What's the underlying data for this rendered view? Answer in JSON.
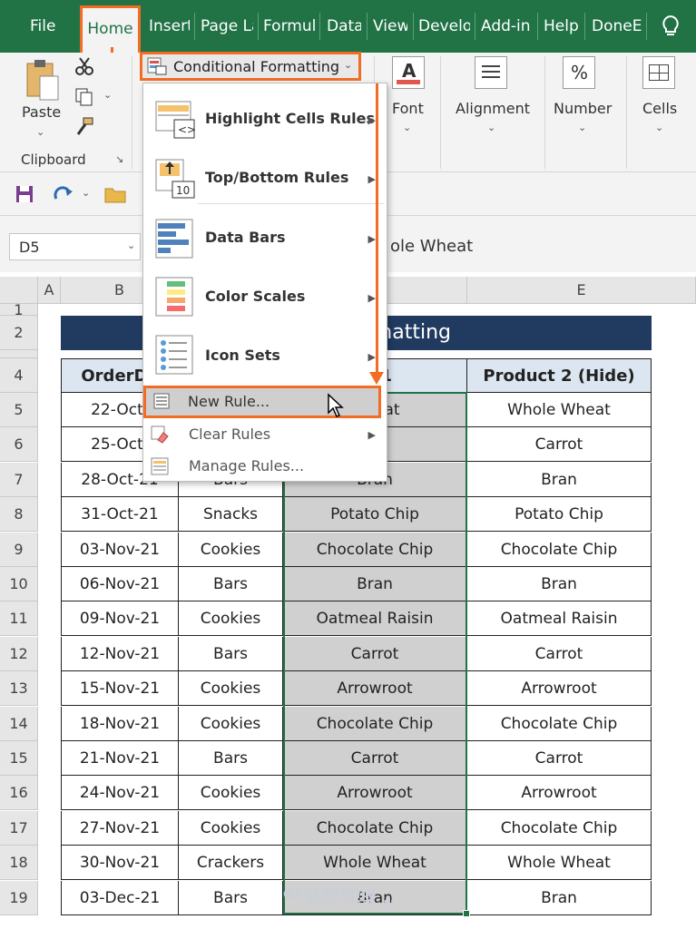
{
  "tabs": [
    "File",
    "Home",
    "Insert",
    "Page La",
    "Formul",
    "Data",
    "View",
    "Develo",
    "Add-in",
    "Help",
    "DoneEx"
  ],
  "ribbon": {
    "paste_label": "Paste",
    "clipboard_label": "Clipboard",
    "cf_button": "Conditional Formatting",
    "font_label": "Font",
    "alignment_label": "Alignment",
    "number_label": "Number",
    "number_icon": "%",
    "cells_label": "Cells",
    "font_icon": "A"
  },
  "formula_bar": {
    "name_box": "D5",
    "content": "ole Wheat"
  },
  "menu": {
    "items": [
      {
        "label": "Highlight Cells Rules",
        "icon": "highlight-cells-icon"
      },
      {
        "label": "Top/Bottom Rules",
        "icon": "top-bottom-icon"
      },
      {
        "label": "Data Bars",
        "icon": "data-bars-icon"
      },
      {
        "label": "Color Scales",
        "icon": "color-scales-icon"
      },
      {
        "label": "Icon Sets",
        "icon": "icon-sets-icon"
      }
    ],
    "new_rule": "New Rule...",
    "clear_rules": "Clear Rules",
    "manage_rules": "Manage Rules..."
  },
  "columns": [
    "A",
    "B",
    "C",
    "D",
    "E"
  ],
  "row_numbers": [
    "1",
    "2",
    "4",
    "5",
    "6",
    "7",
    "8",
    "9",
    "10",
    "11",
    "12",
    "13",
    "14",
    "15",
    "16",
    "17",
    "18",
    "19"
  ],
  "sheet": {
    "title": "ditional Formatting",
    "headers": [
      "OrderDa",
      "",
      "ct 1",
      "Product 2 (Hide)"
    ],
    "rows": [
      [
        "22-Oct-",
        "",
        "Wheat",
        "Whole Wheat"
      ],
      [
        "25-Oct-",
        "",
        "ot",
        "Carrot"
      ],
      [
        "28-Oct-21",
        "Bars",
        "Bran",
        "Bran"
      ],
      [
        "31-Oct-21",
        "Snacks",
        "Potato Chip",
        "Potato Chip"
      ],
      [
        "03-Nov-21",
        "Cookies",
        "Chocolate Chip",
        "Chocolate Chip"
      ],
      [
        "06-Nov-21",
        "Bars",
        "Bran",
        "Bran"
      ],
      [
        "09-Nov-21",
        "Cookies",
        "Oatmeal Raisin",
        "Oatmeal Raisin"
      ],
      [
        "12-Nov-21",
        "Bars",
        "Carrot",
        "Carrot"
      ],
      [
        "15-Nov-21",
        "Cookies",
        "Arrowroot",
        "Arrowroot"
      ],
      [
        "18-Nov-21",
        "Cookies",
        "Chocolate Chip",
        "Chocolate Chip"
      ],
      [
        "21-Nov-21",
        "Bars",
        "Carrot",
        "Carrot"
      ],
      [
        "24-Nov-21",
        "Cookies",
        "Arrowroot",
        "Arrowroot"
      ],
      [
        "27-Nov-21",
        "Cookies",
        "Chocolate Chip",
        "Chocolate Chip"
      ],
      [
        "30-Nov-21",
        "Crackers",
        "Whole Wheat",
        "Whole Wheat"
      ],
      [
        "03-Dec-21",
        "Bars",
        "Bran",
        "Bran"
      ]
    ]
  },
  "watermark": "exceldemy",
  "watermark_sub": "EXCEL · DATA · BI",
  "colors": {
    "excel_green": "#217346",
    "highlight": "#f26c24",
    "banner": "#213a5f",
    "header_fill": "#dce6f1"
  }
}
